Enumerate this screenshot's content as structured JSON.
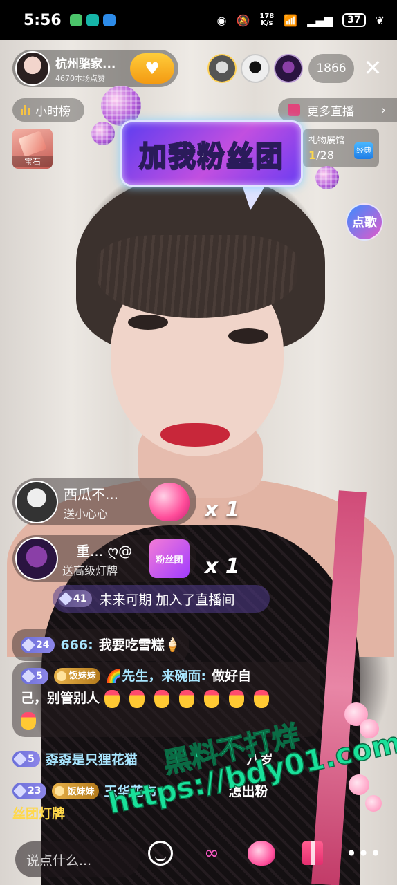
{
  "status_bar": {
    "time": "5:56",
    "speed_value": "178",
    "speed_unit": "K/s",
    "battery": "37"
  },
  "host": {
    "name": "杭州骆家...",
    "likes": "4670本场点赞"
  },
  "viewers": {
    "count": "1866"
  },
  "rank": {
    "label": "小时榜"
  },
  "more_live": {
    "label": "更多直播"
  },
  "gem_box": {
    "label": "宝石"
  },
  "gift_hall": {
    "title": "礼物展馆",
    "current": "1",
    "total": "/28",
    "badge": "经典"
  },
  "sticker": {
    "text": "加我粉丝团"
  },
  "song_button": {
    "label": "点歌"
  },
  "gift_banners": [
    {
      "name": "西瓜不...",
      "action": "送小心心",
      "multiplier": "x 1"
    },
    {
      "name": "重... ღ@",
      "action": "送高级灯牌",
      "gift_text": "粉丝团",
      "multiplier": "x 1"
    }
  ],
  "enter_notice": {
    "level": "41",
    "text": "未来可期 加入了直播间"
  },
  "chat": [
    {
      "level": "24",
      "nick": "666:",
      "msg": "我要吃雪糕🍦"
    },
    {
      "level": "5",
      "fan_tag": "饭妹妹",
      "nick": "🌈先生，来碗面:",
      "msg_line1": "做好自",
      "msg_line2": "己，别管别人"
    },
    {
      "level": "5",
      "nick": "孬孬是只狸花猫",
      "msg": "八岁"
    },
    {
      "level": "23",
      "fan_tag": "饭妹妹",
      "nick": "玉华花布",
      "msg": "怎出粉"
    },
    {
      "nick": "丝团灯牌"
    }
  ],
  "watermark": {
    "line1": "黑料不打烊",
    "line2": "https://bdy01.com"
  },
  "bottom_bar": {
    "placeholder": "说点什么..."
  }
}
